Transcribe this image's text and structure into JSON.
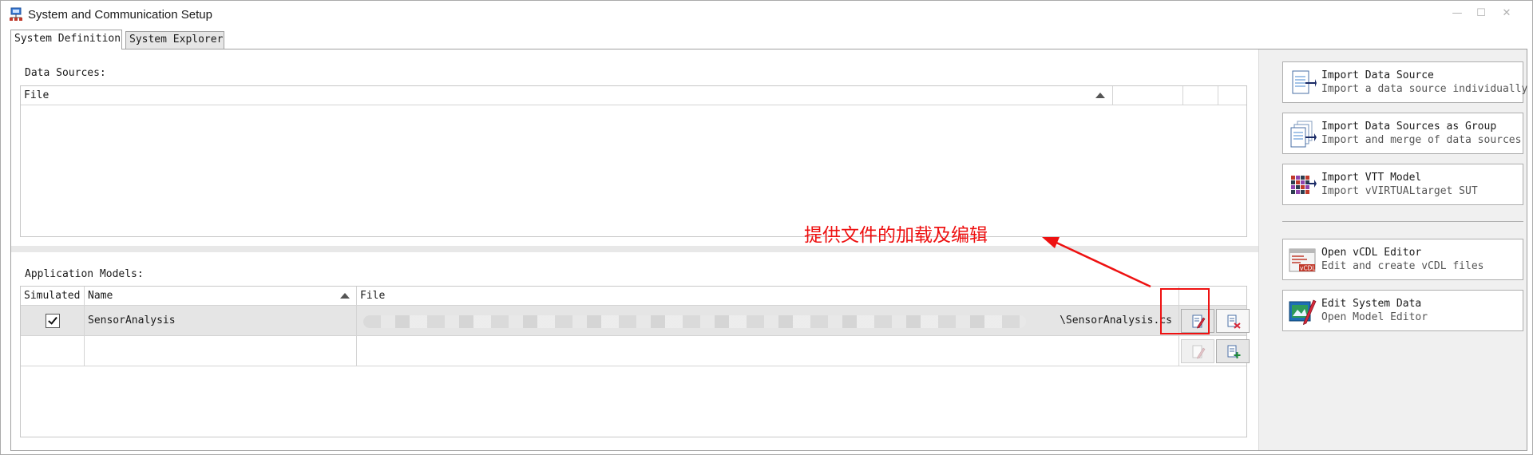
{
  "window": {
    "title": "System and Communication Setup",
    "controls": {
      "minimize": "—",
      "maximize": "☐",
      "close": "✕"
    }
  },
  "tabs": [
    {
      "label": "System Definition",
      "active": true
    },
    {
      "label": "System Explorer",
      "active": false
    }
  ],
  "data_sources": {
    "label": "Data Sources:",
    "columns": [
      "File",
      "",
      "",
      ""
    ],
    "sort_column": "File",
    "rows": []
  },
  "application_models": {
    "label": "Application Models:",
    "columns": [
      "Simulated",
      "Name",
      "File",
      ""
    ],
    "sort_column": "Name",
    "rows": [
      {
        "simulated": true,
        "name": "SensorAnalysis",
        "file": "\\SensorAnalysis.cs",
        "file_path_blurred": true,
        "selected": true
      },
      {
        "simulated": null,
        "name": "",
        "file": "",
        "selected": false
      }
    ]
  },
  "annotation": {
    "text": "提供文件的加载及编辑",
    "color": "#ee1111"
  },
  "actions": [
    {
      "title": "Import Data Source",
      "desc": "Import a data source individually",
      "icon": "document-import-icon"
    },
    {
      "title": "Import Data Sources as Group",
      "desc": "Import and merge of data sources",
      "icon": "documents-group-import-icon"
    },
    {
      "title": "Import VTT Model",
      "desc": "Import vVIRTUALtarget SUT",
      "icon": "vtt-model-icon"
    },
    {
      "title": "Open vCDL Editor",
      "desc": "Edit and create vCDL files",
      "icon": "vcdl-editor-icon"
    },
    {
      "title": "Edit System Data",
      "desc": "Open Model Editor",
      "icon": "edit-system-data-icon"
    }
  ]
}
